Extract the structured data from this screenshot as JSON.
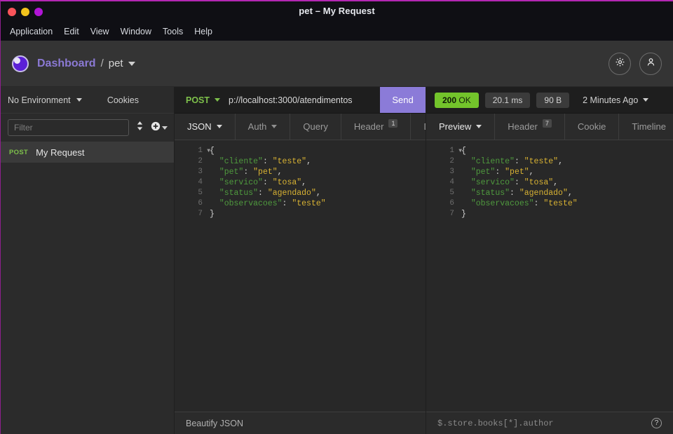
{
  "window": {
    "title": "pet – My Request"
  },
  "menubar": {
    "items": [
      {
        "label": "Application"
      },
      {
        "label": "Edit"
      },
      {
        "label": "View"
      },
      {
        "label": "Window"
      },
      {
        "label": "Tools"
      },
      {
        "label": "Help"
      }
    ]
  },
  "header": {
    "breadcrumb_root": "Dashboard",
    "breadcrumb_separator": "/",
    "breadcrumb_current": "pet",
    "settings_icon": "gear-icon",
    "account_icon": "user-icon"
  },
  "sidebar": {
    "environment": "No Environment",
    "cookies_label": "Cookies",
    "filter_placeholder": "Filter",
    "filter_value": "",
    "sort_icon": "sort-updown-icon",
    "add_icon": "plus-circle-icon",
    "requests": [
      {
        "method": "POST",
        "name": "My Request",
        "selected": true
      }
    ]
  },
  "request": {
    "method": "POST",
    "url": "p://localhost:3000/atendimentos",
    "send_label": "Send",
    "tabs": [
      {
        "label": "JSON",
        "active": true,
        "dropdown": true,
        "badge": ""
      },
      {
        "label": "Auth",
        "active": false,
        "dropdown": true,
        "badge": ""
      },
      {
        "label": "Query",
        "active": false,
        "dropdown": false,
        "badge": ""
      },
      {
        "label": "Header",
        "active": false,
        "dropdown": false,
        "badge": "1"
      },
      {
        "label": "Do",
        "active": false,
        "dropdown": false,
        "badge": ""
      }
    ],
    "body_lines": [
      {
        "n": "1",
        "fold": true,
        "tokens": [
          {
            "t": "pun",
            "v": "{"
          }
        ]
      },
      {
        "n": "2",
        "fold": false,
        "tokens": [
          {
            "t": "pun",
            "v": "  "
          },
          {
            "t": "key",
            "v": "\"cliente\""
          },
          {
            "t": "pun",
            "v": ": "
          },
          {
            "t": "str",
            "v": "\"teste\""
          },
          {
            "t": "pun",
            "v": ","
          }
        ]
      },
      {
        "n": "3",
        "fold": false,
        "tokens": [
          {
            "t": "pun",
            "v": "  "
          },
          {
            "t": "key",
            "v": "\"pet\""
          },
          {
            "t": "pun",
            "v": ": "
          },
          {
            "t": "str",
            "v": "\"pet\""
          },
          {
            "t": "pun",
            "v": ","
          }
        ]
      },
      {
        "n": "4",
        "fold": false,
        "tokens": [
          {
            "t": "pun",
            "v": "  "
          },
          {
            "t": "key",
            "v": "\"servico\""
          },
          {
            "t": "pun",
            "v": ": "
          },
          {
            "t": "str",
            "v": "\"tosa\""
          },
          {
            "t": "pun",
            "v": ","
          }
        ]
      },
      {
        "n": "5",
        "fold": false,
        "tokens": [
          {
            "t": "pun",
            "v": "  "
          },
          {
            "t": "key",
            "v": "\"status\""
          },
          {
            "t": "pun",
            "v": ": "
          },
          {
            "t": "str",
            "v": "\"agendado\""
          },
          {
            "t": "pun",
            "v": ","
          }
        ]
      },
      {
        "n": "6",
        "fold": false,
        "tokens": [
          {
            "t": "pun",
            "v": "  "
          },
          {
            "t": "key",
            "v": "\"observacoes\""
          },
          {
            "t": "pun",
            "v": ": "
          },
          {
            "t": "str",
            "v": "\"teste\""
          }
        ]
      },
      {
        "n": "7",
        "fold": false,
        "tokens": [
          {
            "t": "pun",
            "v": "}"
          }
        ]
      }
    ],
    "footer_label": "Beautify JSON"
  },
  "response": {
    "status_code": "200",
    "status_text": "OK",
    "time": "20.1 ms",
    "size": "90 B",
    "timeago": "2 Minutes Ago",
    "tabs": [
      {
        "label": "Preview",
        "active": true,
        "dropdown": true,
        "badge": ""
      },
      {
        "label": "Header",
        "active": false,
        "dropdown": false,
        "badge": "7"
      },
      {
        "label": "Cookie",
        "active": false,
        "dropdown": false,
        "badge": ""
      },
      {
        "label": "Timeline",
        "active": false,
        "dropdown": false,
        "badge": ""
      }
    ],
    "body_lines": [
      {
        "n": "1",
        "fold": true,
        "tokens": [
          {
            "t": "pun",
            "v": "{"
          }
        ]
      },
      {
        "n": "2",
        "fold": false,
        "tokens": [
          {
            "t": "pun",
            "v": "  "
          },
          {
            "t": "key",
            "v": "\"cliente\""
          },
          {
            "t": "pun",
            "v": ": "
          },
          {
            "t": "str",
            "v": "\"teste\""
          },
          {
            "t": "pun",
            "v": ","
          }
        ]
      },
      {
        "n": "3",
        "fold": false,
        "tokens": [
          {
            "t": "pun",
            "v": "  "
          },
          {
            "t": "key",
            "v": "\"pet\""
          },
          {
            "t": "pun",
            "v": ": "
          },
          {
            "t": "str",
            "v": "\"pet\""
          },
          {
            "t": "pun",
            "v": ","
          }
        ]
      },
      {
        "n": "4",
        "fold": false,
        "tokens": [
          {
            "t": "pun",
            "v": "  "
          },
          {
            "t": "key",
            "v": "\"servico\""
          },
          {
            "t": "pun",
            "v": ": "
          },
          {
            "t": "str",
            "v": "\"tosa\""
          },
          {
            "t": "pun",
            "v": ","
          }
        ]
      },
      {
        "n": "5",
        "fold": false,
        "tokens": [
          {
            "t": "pun",
            "v": "  "
          },
          {
            "t": "key",
            "v": "\"status\""
          },
          {
            "t": "pun",
            "v": ": "
          },
          {
            "t": "str",
            "v": "\"agendado\""
          },
          {
            "t": "pun",
            "v": ","
          }
        ]
      },
      {
        "n": "6",
        "fold": false,
        "tokens": [
          {
            "t": "pun",
            "v": "  "
          },
          {
            "t": "key",
            "v": "\"observacoes\""
          },
          {
            "t": "pun",
            "v": ": "
          },
          {
            "t": "str",
            "v": "\"teste\""
          }
        ]
      },
      {
        "n": "7",
        "fold": false,
        "tokens": [
          {
            "t": "pun",
            "v": "}"
          }
        ]
      }
    ],
    "jsonpath_placeholder": "$.store.books[*].author",
    "jsonpath_value": "",
    "help_icon": "question-mark-icon"
  },
  "colors": {
    "accent_purple": "#8b7bd8",
    "status_green": "#73c42b",
    "method_green": "#7ec14b",
    "brand_magenta": "#b327b3",
    "json_key": "#4f9a3e",
    "json_string": "#d8b233"
  }
}
